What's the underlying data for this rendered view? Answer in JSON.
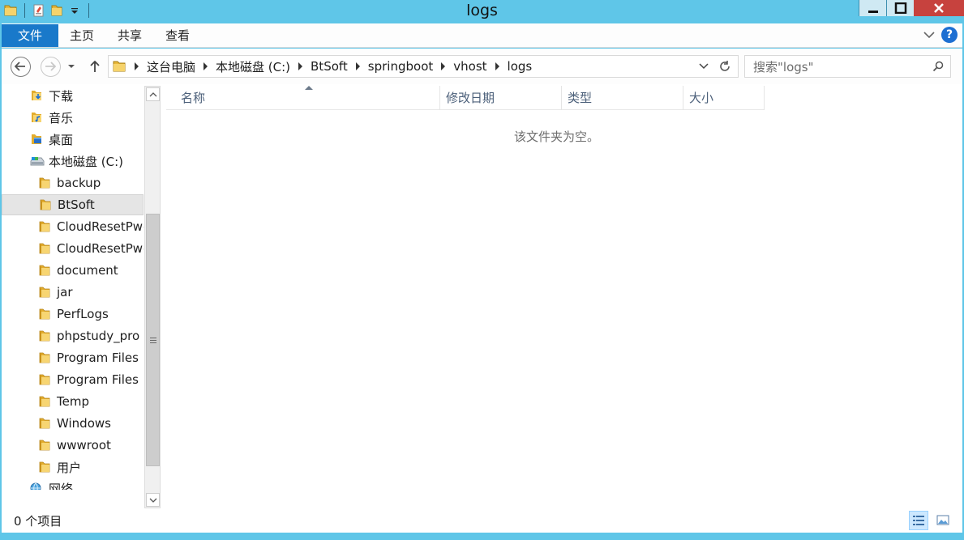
{
  "window": {
    "title": "logs"
  },
  "ribbon": {
    "tabs": [
      {
        "label": "文件"
      },
      {
        "label": "主页"
      },
      {
        "label": "共享"
      },
      {
        "label": "查看"
      }
    ],
    "help_label": "?"
  },
  "address": {
    "crumbs": [
      "这台电脑",
      "本地磁盘 (C:)",
      "BtSoft",
      "springboot",
      "vhost",
      "logs"
    ]
  },
  "search": {
    "placeholder": "搜索\"logs\""
  },
  "tree": {
    "items": [
      {
        "label": "下载",
        "icon": "download-folder-icon",
        "indent": 0
      },
      {
        "label": "音乐",
        "icon": "music-folder-icon",
        "indent": 0
      },
      {
        "label": "桌面",
        "icon": "desktop-folder-icon",
        "indent": 0
      },
      {
        "label": "本地磁盘 (C:)",
        "icon": "drive-icon",
        "indent": 0
      },
      {
        "label": "backup",
        "icon": "folder-icon",
        "indent": 1
      },
      {
        "label": "BtSoft",
        "icon": "folder-icon",
        "indent": 1,
        "selected": true
      },
      {
        "label": "CloudResetPwd",
        "icon": "folder-icon",
        "indent": 1
      },
      {
        "label": "CloudResetPwd",
        "icon": "folder-icon",
        "indent": 1
      },
      {
        "label": "document",
        "icon": "folder-icon",
        "indent": 1
      },
      {
        "label": "jar",
        "icon": "folder-icon",
        "indent": 1
      },
      {
        "label": "PerfLogs",
        "icon": "folder-icon",
        "indent": 1
      },
      {
        "label": "phpstudy_pro",
        "icon": "folder-icon",
        "indent": 1
      },
      {
        "label": "Program Files",
        "icon": "folder-icon",
        "indent": 1
      },
      {
        "label": "Program Files (",
        "icon": "folder-icon",
        "indent": 1
      },
      {
        "label": "Temp",
        "icon": "folder-icon",
        "indent": 1
      },
      {
        "label": "Windows",
        "icon": "folder-icon",
        "indent": 1
      },
      {
        "label": "wwwroot",
        "icon": "folder-icon",
        "indent": 1
      },
      {
        "label": "用户",
        "icon": "folder-icon",
        "indent": 1
      },
      {
        "label": "网络",
        "icon": "network-icon",
        "indent": 0,
        "partial": true
      }
    ]
  },
  "columns": [
    {
      "label": "名称"
    },
    {
      "label": "修改日期"
    },
    {
      "label": "类型"
    },
    {
      "label": "大小"
    }
  ],
  "empty_message": "该文件夹为空。",
  "status": {
    "item_count": "0 个项目"
  },
  "colors": {
    "titlebar": "#5fc6e8",
    "file_tab": "#1979ca",
    "close_button": "#c7423e",
    "folder_yellow": "#f0c040"
  }
}
